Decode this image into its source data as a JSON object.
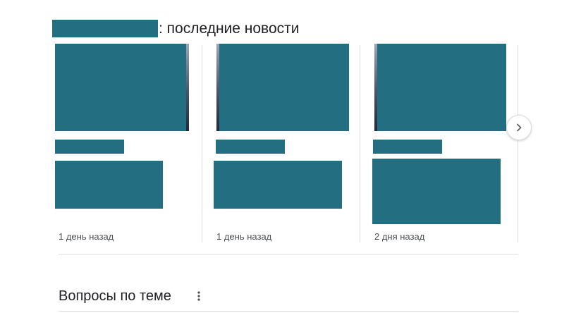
{
  "news": {
    "title": ": последние новости",
    "cards": [
      {
        "time": "1 день назад"
      },
      {
        "time": "1 день назад"
      },
      {
        "time": "2 дня назад"
      }
    ]
  },
  "questions": {
    "title": "Вопросы по теме"
  },
  "icons": {
    "next": "chevron-right-icon",
    "more": "more-vert-icon"
  },
  "colors": {
    "redaction": "#236e80",
    "divider": "#dadce0",
    "text": "#202124",
    "secondary_text": "#4d5156"
  }
}
